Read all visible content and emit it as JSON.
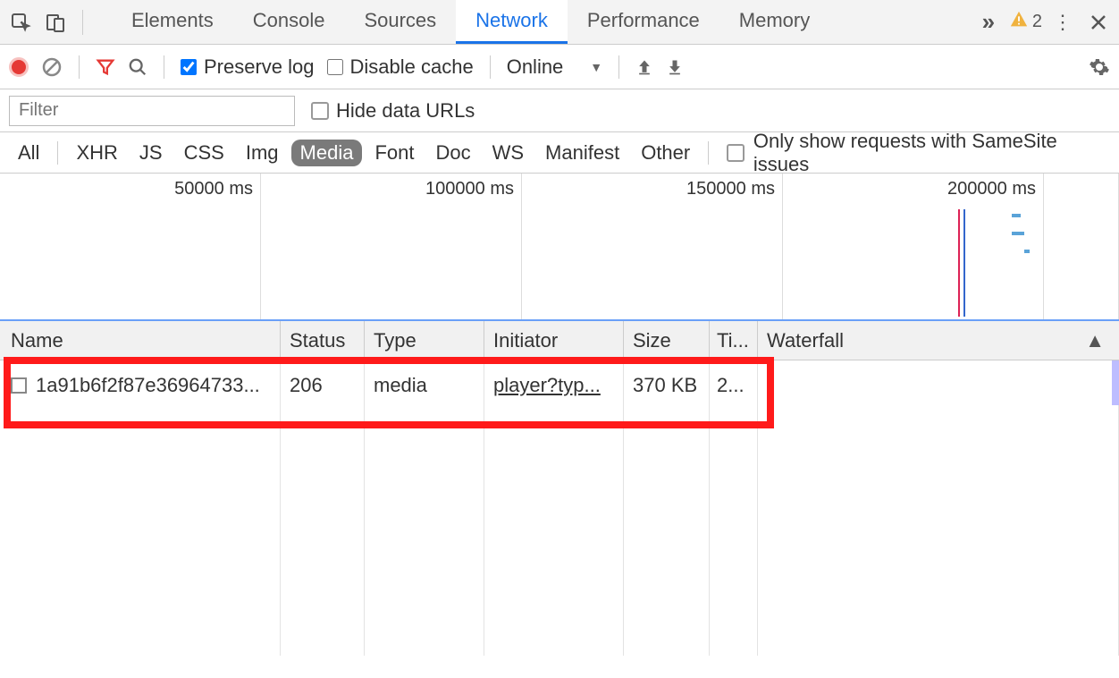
{
  "tabs": {
    "items": [
      "Elements",
      "Console",
      "Sources",
      "Network",
      "Performance",
      "Memory"
    ],
    "active": "Network",
    "more_glyph": "»",
    "warnings_count": "2"
  },
  "toolbar": {
    "preserve_log": "Preserve log",
    "disable_cache": "Disable cache",
    "throttling": "Online"
  },
  "filter": {
    "placeholder": "Filter",
    "hide_data_urls": "Hide data URLs"
  },
  "types": {
    "items": [
      "All",
      "XHR",
      "JS",
      "CSS",
      "Img",
      "Media",
      "Font",
      "Doc",
      "WS",
      "Manifest",
      "Other"
    ],
    "active": "Media",
    "samesite": "Only show requests with SameSite issues"
  },
  "timeline": {
    "ticks": [
      "50000 ms",
      "100000 ms",
      "150000 ms",
      "200000 ms"
    ]
  },
  "columns": {
    "name": "Name",
    "status": "Status",
    "type": "Type",
    "initiator": "Initiator",
    "size": "Size",
    "time": "Ti...",
    "waterfall": "Waterfall",
    "sort_glyph": "▲"
  },
  "rows": [
    {
      "name": "1a91b6f2f87e36964733...",
      "status": "206",
      "type": "media",
      "initiator": "player?typ...",
      "size": "370 KB",
      "time": "2..."
    }
  ]
}
